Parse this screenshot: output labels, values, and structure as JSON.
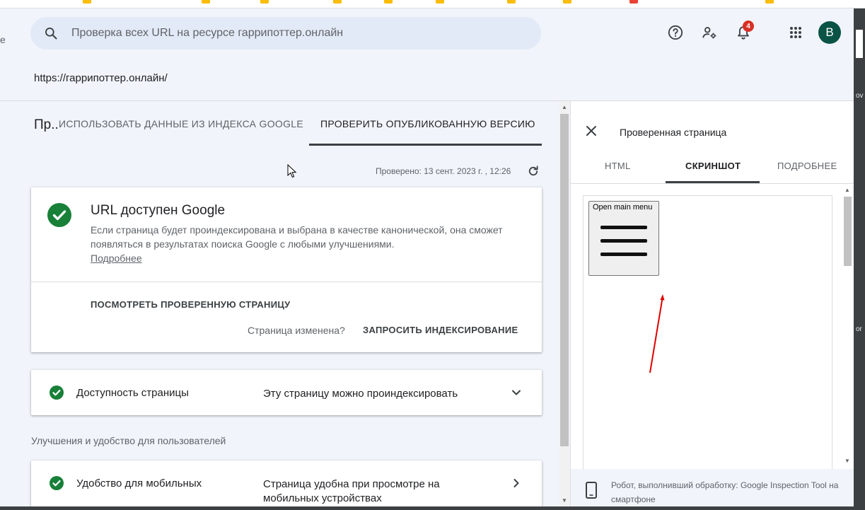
{
  "header": {
    "search_placeholder": "Проверка всех URL на ресурсе гаррипоттер.онлайн",
    "notification_count": "4",
    "avatar_letter": "B",
    "left_nub": "e"
  },
  "property_url": "https://гаррипоттер.онлайн/",
  "tabs": {
    "title_short": "Пр..",
    "index_tab": "ИСПОЛЬЗОВАТЬ ДАННЫЕ ИЗ ИНДЕКСА GOOGLE",
    "live_tab": "ПРОВЕРИТЬ ОПУБЛИКОВАННУЮ ВЕРСИЮ"
  },
  "checked_at": "Проверено: 13 сент. 2023 г. , 12:26",
  "main_card": {
    "title": "URL доступен Google",
    "description": "Если страница будет проиндексирована и выбрана в качестве канонической, она сможет появляться в результатах поиска Google с любыми улучшениями.",
    "learn_more": "Подробнее",
    "view_tested": "ПОСМОТРЕТЬ ПРОВЕРЕННУЮ СТРАНИЦУ",
    "page_changed": "Страница изменена?",
    "request_indexing": "ЗАПРОСИТЬ ИНДЕКСИРОВАНИЕ"
  },
  "availability_row": {
    "label": "Доступность страницы",
    "value": "Эту страницу можно проиндексировать"
  },
  "enhancements_section": "Улучшения и удобство для пользователей",
  "mobile_row": {
    "label": "Удобство для мобильных",
    "value": "Страница удобна при просмотре на мобильных устройствах"
  },
  "panel": {
    "title": "Проверенная страница",
    "tabs": [
      "HTML",
      "СКРИНШОТ",
      "ПОДРОБНЕЕ"
    ],
    "active_tab": "СКРИНШОТ",
    "screenshot_button_label": "Open main menu",
    "footer": "Робот, выполнивший обработку: Google Inspection Tool на смартфоне"
  },
  "outer_edge_text": [
    "ov",
    "or"
  ],
  "colors": {
    "success_green": "#188038",
    "badge_red": "#d93025",
    "avatar_bg": "#0b5345",
    "annotation_red": "#e00000"
  }
}
